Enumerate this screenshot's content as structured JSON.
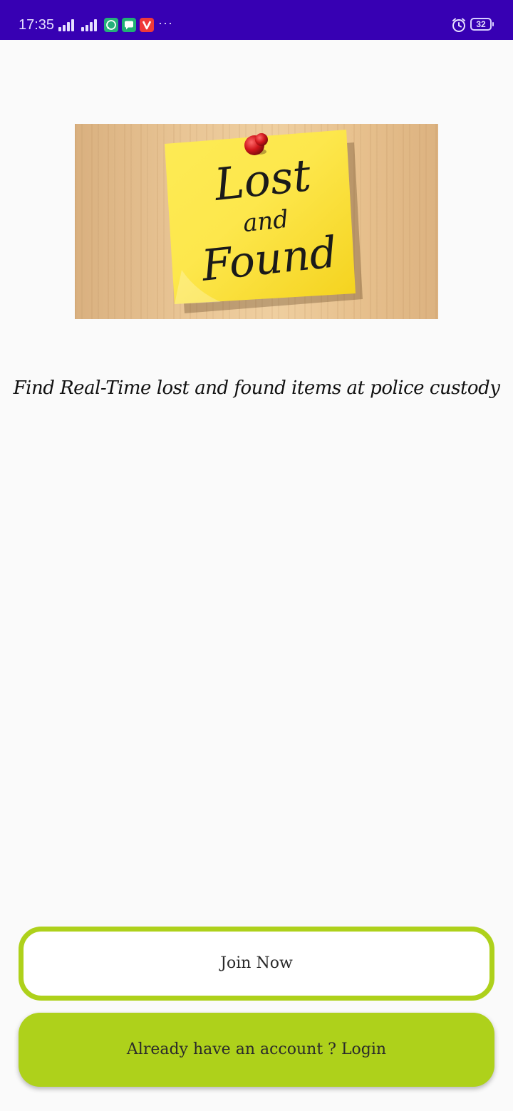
{
  "status_bar": {
    "time": "17:35",
    "notification_icons": [
      "whatsapp-icon",
      "messages-icon",
      "vivaldi-icon"
    ],
    "more_indicator": "···",
    "battery_level": "32",
    "background_color": "#3700b3"
  },
  "hero": {
    "note_line_1": "Lost",
    "note_line_2": "and",
    "note_line_3": "Found"
  },
  "tagline": "Find Real-Time lost and found items at police custody",
  "buttons": {
    "join_label": "Join Now",
    "login_label": "Already have an account ? Login"
  },
  "colors": {
    "accent": "#aed11b",
    "page_background": "#fafafa",
    "note_yellow": "#fde74c",
    "pin_red": "#d0161b"
  }
}
